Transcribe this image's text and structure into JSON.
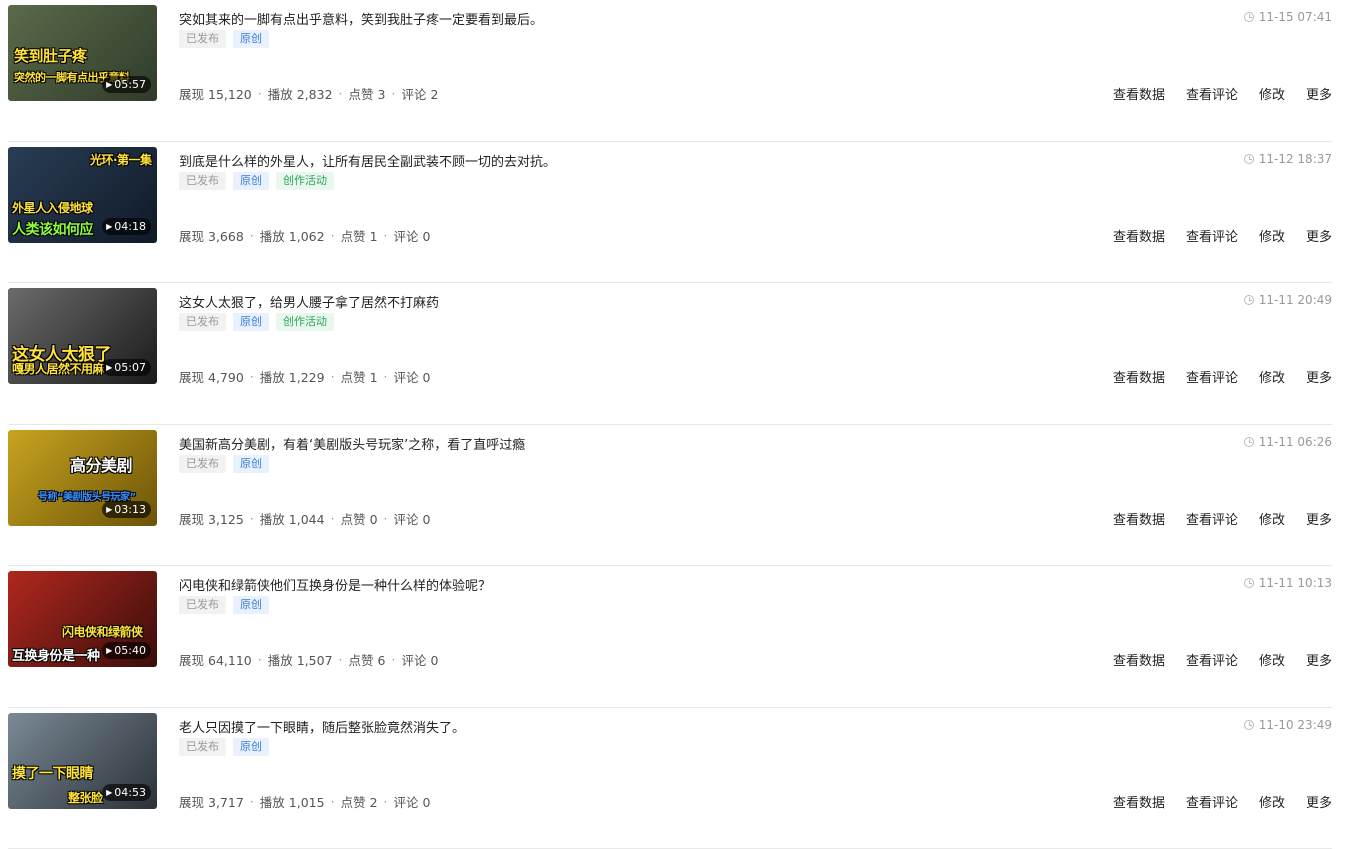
{
  "actions": {
    "view_data": "查看数据",
    "view_comments": "查看评论",
    "edit": "修改",
    "more": "更多"
  },
  "labels": {
    "impressions": "展现",
    "plays": "播放",
    "likes": "点赞",
    "comments": "评论"
  },
  "videos": [
    {
      "title": "突如其来的一脚有点出乎意料，笑到我肚子疼一定要看到最后。",
      "status": "已发布",
      "original": "原创",
      "activity": null,
      "impressions": "15,120",
      "plays": "2,832",
      "likes": "3",
      "comments": "2",
      "time": "11-15 07:41",
      "duration": "05:57",
      "thumb_caption_1": "笑到肚子疼",
      "thumb_caption_2": "突然的一脚有点出乎意料",
      "thumb_colors": [
        "#5a6a4a",
        "#2f3b2a"
      ]
    },
    {
      "title": "到底是什么样的外星人，让所有居民全副武装不顾一切的去对抗。",
      "status": "已发布",
      "original": "原创",
      "activity": "创作活动",
      "impressions": "3,668",
      "plays": "1,062",
      "likes": "1",
      "comments": "0",
      "time": "11-12 18:37",
      "duration": "04:18",
      "thumb_caption_1": "光环·第一集",
      "thumb_caption_2": "外星人入侵地球",
      "thumb_caption_3": "人类该如何应",
      "thumb_colors": [
        "#2a3d55",
        "#0f1a28"
      ]
    },
    {
      "title": "这女人太狠了，给男人腰子拿了居然不打麻药",
      "status": "已发布",
      "original": "原创",
      "activity": "创作活动",
      "impressions": "4,790",
      "plays": "1,229",
      "likes": "1",
      "comments": "0",
      "time": "11-11 20:49",
      "duration": "05:07",
      "thumb_caption_1": "这女人太狠了",
      "thumb_caption_2": "嘎男人居然不用麻",
      "thumb_colors": [
        "#6b6b6b",
        "#1a1a1a"
      ]
    },
    {
      "title": "美国新高分美剧，有着‘美剧版头号玩家’之称，看了直呼过瘾",
      "status": "已发布",
      "original": "原创",
      "activity": null,
      "impressions": "3,125",
      "plays": "1,044",
      "likes": "0",
      "comments": "0",
      "time": "11-11 06:26",
      "duration": "03:13",
      "thumb_caption_1": "高分美剧",
      "thumb_caption_2": "号称“美剧版头号玩家”",
      "thumb_colors": [
        "#c9a420",
        "#6b5408"
      ]
    },
    {
      "title": "闪电侠和绿箭侠他们互换身份是一种什么样的体验呢？",
      "status": "已发布",
      "original": "原创",
      "activity": null,
      "impressions": "64,110",
      "plays": "1,507",
      "likes": "6",
      "comments": "0",
      "time": "11-11 10:13",
      "duration": "05:40",
      "thumb_caption_1": "闪电侠和绿箭侠",
      "thumb_caption_2": "互换身份是一种",
      "thumb_colors": [
        "#b0281e",
        "#3a0d0a"
      ]
    },
    {
      "title": "老人只因摸了一下眼睛，随后整张脸竟然消失了。",
      "status": "已发布",
      "original": "原创",
      "activity": null,
      "impressions": "3,717",
      "plays": "1,015",
      "likes": "2",
      "comments": "0",
      "time": "11-10 23:49",
      "duration": "04:53",
      "thumb_caption_1": "摸了一下眼睛",
      "thumb_caption_2": "整张脸",
      "thumb_colors": [
        "#7a8a96",
        "#2b3138"
      ]
    }
  ]
}
